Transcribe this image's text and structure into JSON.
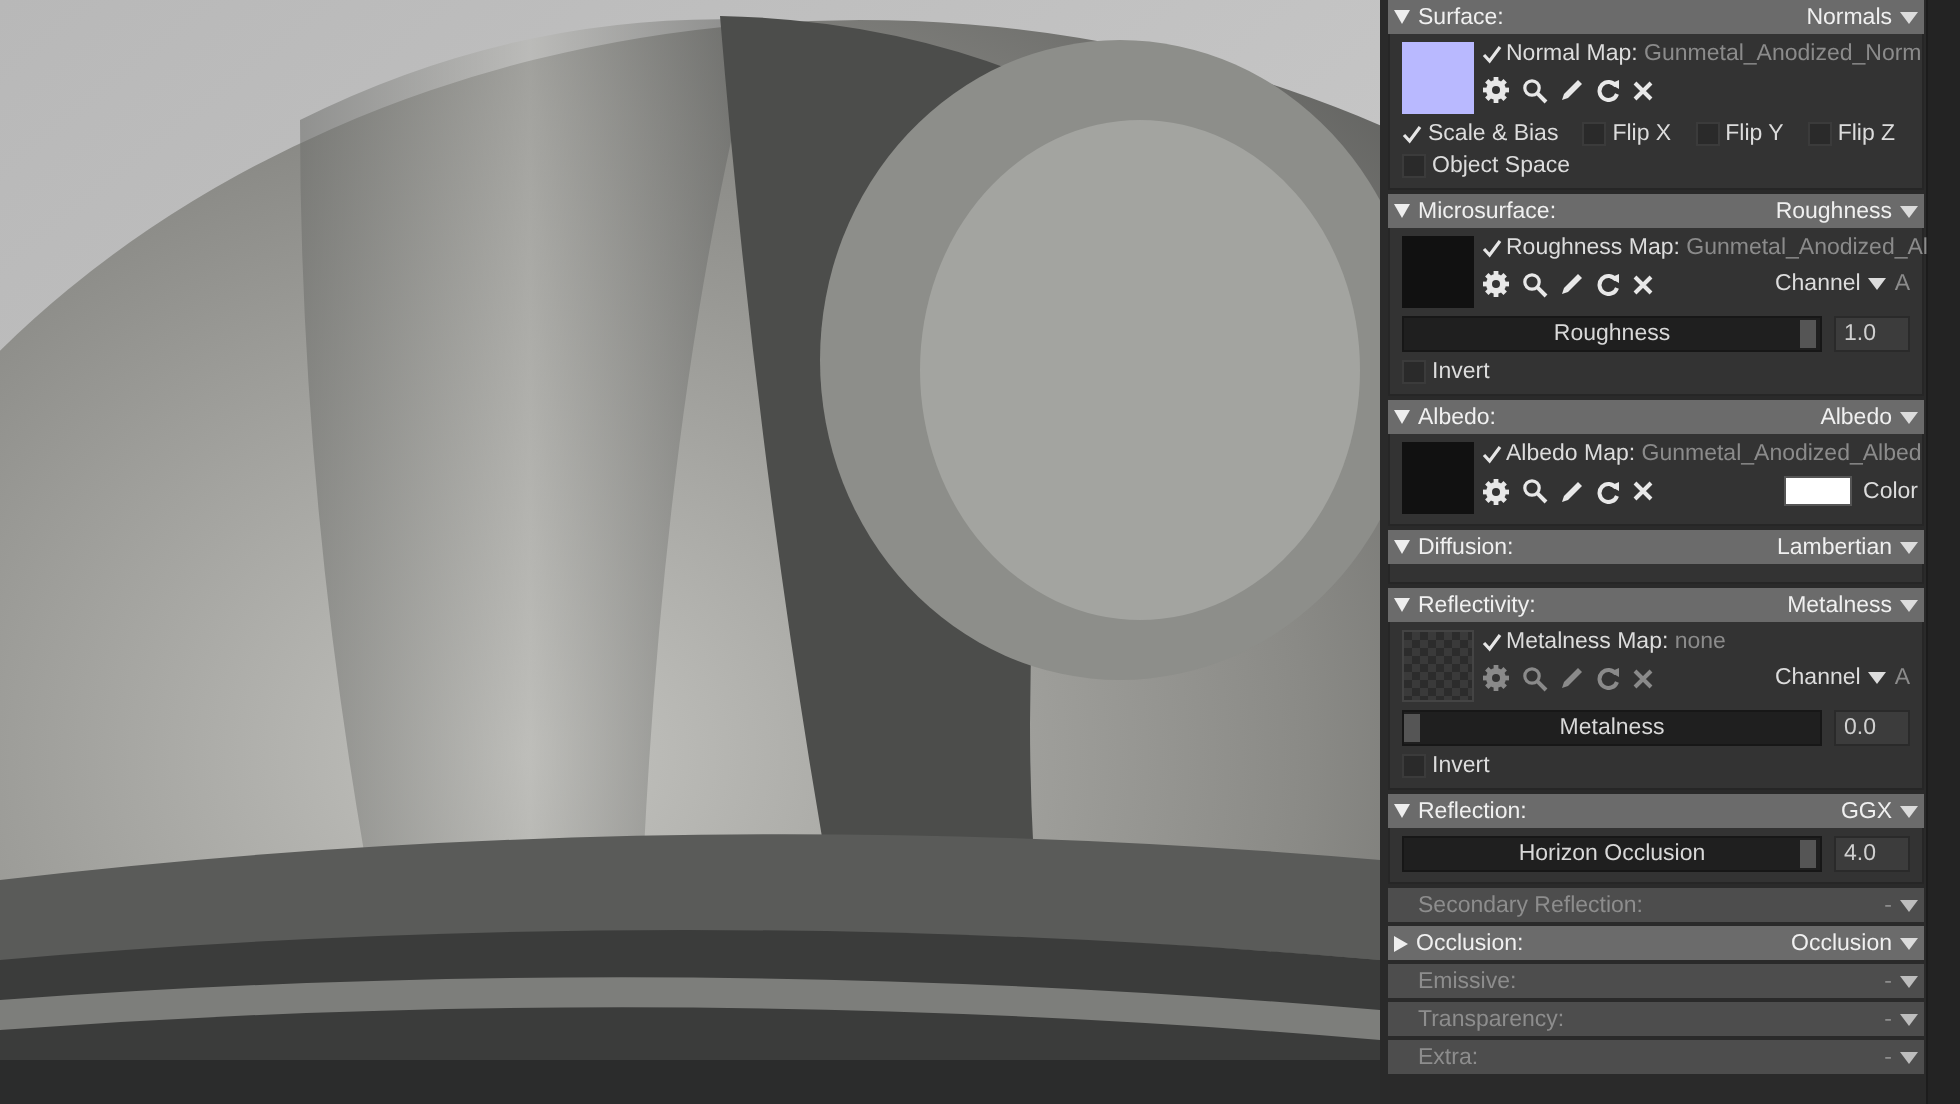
{
  "sections": [
    {
      "title": "Surface:",
      "mode": "Normals",
      "enabled": true,
      "expanded": true,
      "content": [
        {
          "kind": "map",
          "label": "Normal Map:",
          "file": "Gunmetal_Anodized_Norm",
          "checked": true,
          "dimmed": false,
          "color": "#b9b9ff"
        },
        {
          "kind": "checks",
          "items": [
            {
              "label": "Scale & Bias",
              "checked": true
            },
            {
              "label": "Flip X",
              "checked": false
            },
            {
              "label": "Flip Y",
              "checked": false
            },
            {
              "label": "Flip Z",
              "checked": false
            }
          ]
        },
        {
          "kind": "checks",
          "items": [
            {
              "label": "Object Space",
              "checked": false
            }
          ]
        }
      ]
    },
    {
      "title": "Microsurface:",
      "mode": "Roughness",
      "enabled": true,
      "expanded": true,
      "content": [
        {
          "kind": "map",
          "label": "Roughness Map:",
          "file": "Gunmetal_Anodized_Al",
          "checked": true,
          "dimmed": false,
          "color": "#111111",
          "channel": {
            "label": "Channel",
            "value": "A"
          }
        },
        {
          "kind": "slider",
          "label": "Roughness",
          "level": 1,
          "value": "1.0"
        },
        {
          "kind": "checks",
          "items": [
            {
              "label": "Invert",
              "checked": false
            }
          ]
        }
      ]
    },
    {
      "title": "Albedo:",
      "mode": "Albedo",
      "enabled": true,
      "expanded": true,
      "content": [
        {
          "kind": "map",
          "label": "Albedo Map:",
          "file": "Gunmetal_Anodized_Albed",
          "checked": true,
          "dimmed": false,
          "color": "#111111",
          "tint": {
            "label": "Color",
            "color": "#ffffff"
          }
        }
      ]
    },
    {
      "title": "Diffusion:",
      "mode": "Lambertian",
      "enabled": true,
      "expanded": true
    },
    {
      "title": "Reflectivity:",
      "mode": "Metalness",
      "enabled": true,
      "expanded": true,
      "content": [
        {
          "kind": "map",
          "label": "Metalness Map:",
          "file": "none",
          "checked": true,
          "dimmed": true,
          "channel": {
            "label": "Channel",
            "value": "A"
          }
        },
        {
          "kind": "slider",
          "label": "Metalness",
          "level": 0,
          "value": "0.0"
        },
        {
          "kind": "checks",
          "items": [
            {
              "label": "Invert",
              "checked": false
            }
          ]
        }
      ]
    },
    {
      "title": "Reflection:",
      "mode": "GGX",
      "enabled": true,
      "expanded": true,
      "content": [
        {
          "kind": "slider",
          "label": "Horizon Occlusion",
          "level": 1,
          "value": "4.0"
        }
      ]
    },
    {
      "title": "Secondary Reflection:",
      "mode": "-",
      "enabled": false
    },
    {
      "title": "Occlusion:",
      "mode": "Occlusion",
      "enabled": true,
      "expanded": false
    },
    {
      "title": "Emissive:",
      "mode": "-",
      "enabled": false
    },
    {
      "title": "Transparency:",
      "mode": "-",
      "enabled": false
    },
    {
      "title": "Extra:",
      "mode": "-",
      "enabled": false
    }
  ]
}
